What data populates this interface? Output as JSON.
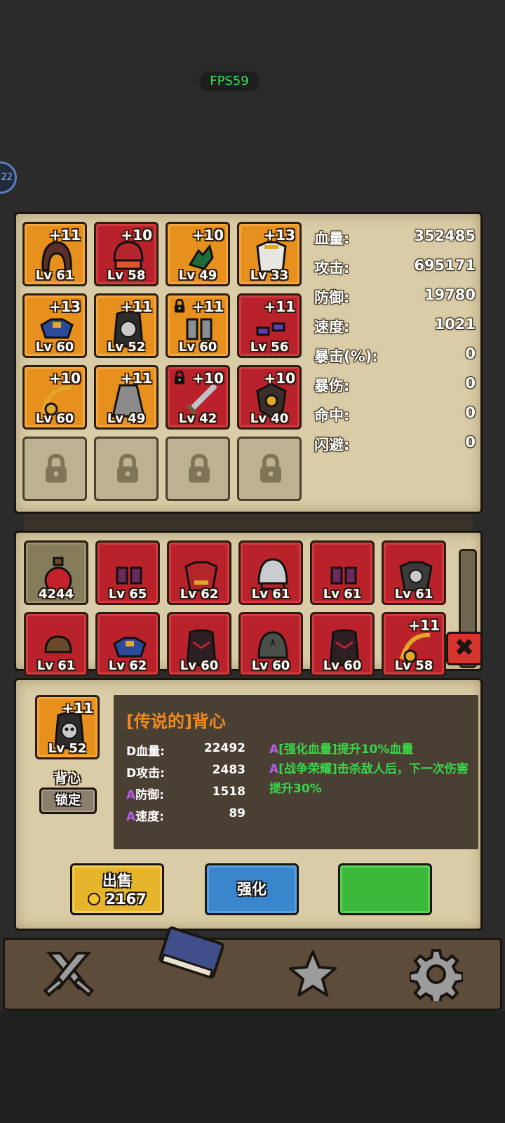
{
  "fps": "FPS59",
  "side_badge": "22",
  "equipped": [
    {
      "plus": "+11",
      "lv": "Lv 61",
      "rarity": "orange",
      "icon": "hood-helmet-icon",
      "locked": false
    },
    {
      "plus": "+10",
      "lv": "Lv 58",
      "rarity": "red",
      "icon": "red-mask-helmet-icon",
      "locked": false
    },
    {
      "plus": "+10",
      "lv": "Lv 49",
      "rarity": "orange",
      "icon": "green-glove-icon",
      "locked": false
    },
    {
      "plus": "+13",
      "lv": "Lv 33",
      "rarity": "orange",
      "icon": "white-armor-icon",
      "locked": false
    },
    {
      "plus": "+13",
      "lv": "Lv 60",
      "rarity": "orange",
      "icon": "blue-shoulder-armor-icon",
      "locked": false
    },
    {
      "plus": "+11",
      "lv": "Lv 52",
      "rarity": "orange",
      "icon": "skull-vest-icon",
      "locked": false
    },
    {
      "plus": "+11",
      "lv": "Lv 60",
      "rarity": "orange",
      "icon": "grey-boots-icon",
      "locked": true
    },
    {
      "plus": "+11",
      "lv": "Lv 56",
      "rarity": "red",
      "icon": "purple-gloves-icon",
      "locked": false
    },
    {
      "plus": "+10",
      "lv": "Lv 60",
      "rarity": "orange",
      "icon": "gold-amulet-icon",
      "locked": false
    },
    {
      "plus": "+11",
      "lv": "Lv 49",
      "rarity": "orange",
      "icon": "grey-cape-icon",
      "locked": false
    },
    {
      "plus": "+10",
      "lv": "Lv 42",
      "rarity": "red",
      "icon": "sword-icon",
      "locked": true
    },
    {
      "plus": "+10",
      "lv": "Lv 40",
      "rarity": "red",
      "icon": "shield-icon",
      "locked": false
    }
  ],
  "stats": [
    {
      "label": "血量:",
      "value": "352485"
    },
    {
      "label": "攻击:",
      "value": "695171"
    },
    {
      "label": "防御:",
      "value": "19780"
    },
    {
      "label": "速度:",
      "value": "1021"
    },
    {
      "label": "暴击(%):",
      "value": "0"
    },
    {
      "label": "暴伤:",
      "value": "0"
    },
    {
      "label": "命中:",
      "value": "0"
    },
    {
      "label": "闪避:",
      "value": "0"
    }
  ],
  "inventory": [
    {
      "plus": "",
      "lv": "4244",
      "rarity": "olive",
      "icon": "red-potion-icon"
    },
    {
      "plus": "",
      "lv": "Lv 65",
      "rarity": "red",
      "icon": "purple-boots-icon"
    },
    {
      "plus": "",
      "lv": "Lv 62",
      "rarity": "red",
      "icon": "red-armor-icon"
    },
    {
      "plus": "",
      "lv": "Lv 61",
      "rarity": "red",
      "icon": "steel-helmet-icon"
    },
    {
      "plus": "",
      "lv": "Lv 61",
      "rarity": "red",
      "icon": "purple-boots-icon"
    },
    {
      "plus": "",
      "lv": "Lv 61",
      "rarity": "red",
      "icon": "skull-armor-icon"
    },
    {
      "plus": "",
      "lv": "Lv 61",
      "rarity": "red",
      "icon": "leather-cap-icon"
    },
    {
      "plus": "",
      "lv": "Lv 62",
      "rarity": "red",
      "icon": "blue-shoulder-armor-icon"
    },
    {
      "plus": "",
      "lv": "Lv 60",
      "rarity": "red",
      "icon": "dark-vest-icon"
    },
    {
      "plus": "",
      "lv": "Lv 60",
      "rarity": "red",
      "icon": "leaf-helmet-icon"
    },
    {
      "plus": "",
      "lv": "Lv 60",
      "rarity": "red",
      "icon": "dark-vest-icon"
    },
    {
      "plus": "+11",
      "lv": "Lv 58",
      "rarity": "red",
      "icon": "gold-amulet-icon"
    }
  ],
  "detail": {
    "plus": "+11",
    "lv": "Lv 52",
    "name": "背心",
    "lock_label": "锁定",
    "title": "[传说的]背心",
    "attrs": [
      {
        "grade": "D",
        "label": "血量:",
        "value": "22492"
      },
      {
        "grade": "D",
        "label": "攻击:",
        "value": "2483"
      },
      {
        "grade": "A",
        "label": "防御:",
        "value": "1518"
      },
      {
        "grade": "A",
        "label": "速度:",
        "value": "89"
      }
    ],
    "skills": [
      {
        "grade": "A",
        "text": "[强化血量]提升10%血量"
      },
      {
        "grade": "A",
        "text": "[战争荣耀]击杀敌人后，下一次伤害提升30%"
      }
    ]
  },
  "buttons": {
    "sell_label": "出售",
    "sell_price": "2167",
    "enhance_label": "强化",
    "third_label": ""
  },
  "nav": [
    {
      "icon": "crossed-swords-icon"
    },
    {
      "icon": "book-icon"
    },
    {
      "icon": "star-icon"
    },
    {
      "icon": "gear-icon"
    }
  ],
  "colors": {
    "orange_rarity": "#e8901e",
    "red_rarity": "#b9222b",
    "parchment": "#d9cca6",
    "sell_button": "#e6b52c",
    "enhance_button": "#3a86cc",
    "green_button": "#3cb83a",
    "skill_text": "#39d64a",
    "title_text": "#f08a1c",
    "grade_a": "#b35ee8"
  }
}
